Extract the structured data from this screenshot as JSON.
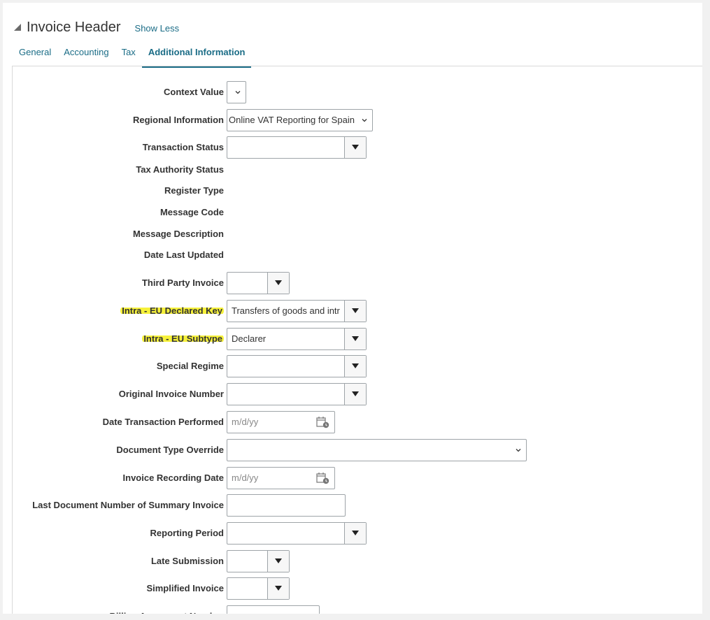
{
  "header": {
    "title": "Invoice Header",
    "toggle_label": "Show Less"
  },
  "tabs": [
    {
      "label": "General"
    },
    {
      "label": "Accounting"
    },
    {
      "label": "Tax"
    },
    {
      "label": "Additional Information"
    }
  ],
  "fields": {
    "context_value": {
      "label": "Context Value",
      "value": ""
    },
    "regional_information": {
      "label": "Regional Information",
      "value": "Online VAT Reporting for Spain"
    },
    "transaction_status": {
      "label": "Transaction Status",
      "value": ""
    },
    "tax_authority_status": {
      "label": "Tax Authority Status"
    },
    "register_type": {
      "label": "Register Type"
    },
    "message_code": {
      "label": "Message Code"
    },
    "message_description": {
      "label": "Message Description"
    },
    "date_last_updated": {
      "label": "Date Last Updated"
    },
    "third_party_invoice": {
      "label": "Third Party Invoice",
      "value": ""
    },
    "intra_eu_declared_key": {
      "label": "Intra - EU Declared Key",
      "value": "Transfers of goods and intr"
    },
    "intra_eu_subtype": {
      "label": "Intra - EU Subtype",
      "value": "Declarer"
    },
    "special_regime": {
      "label": "Special Regime",
      "value": ""
    },
    "original_invoice_number": {
      "label": "Original Invoice Number",
      "value": ""
    },
    "date_transaction_performed": {
      "label": "Date Transaction Performed",
      "placeholder": "m/d/yy"
    },
    "document_type_override": {
      "label": "Document Type Override",
      "value": ""
    },
    "invoice_recording_date": {
      "label": "Invoice Recording Date",
      "placeholder": "m/d/yy"
    },
    "last_document_number_summary": {
      "label": "Last Document Number of Summary Invoice",
      "value": ""
    },
    "reporting_period": {
      "label": "Reporting Period",
      "value": ""
    },
    "late_submission": {
      "label": "Late Submission",
      "value": ""
    },
    "simplified_invoice": {
      "label": "Simplified Invoice",
      "value": ""
    },
    "billing_agreement_number": {
      "label": "Billing Agreement Number",
      "value": ""
    }
  },
  "colors": {
    "link": "#1a6c86",
    "highlight": "#f6f13a",
    "border": "#9ea4a8"
  },
  "icons": [
    "collapse-triangle-icon",
    "chevron-down-icon",
    "triangle-down-icon",
    "calendar-icon"
  ]
}
